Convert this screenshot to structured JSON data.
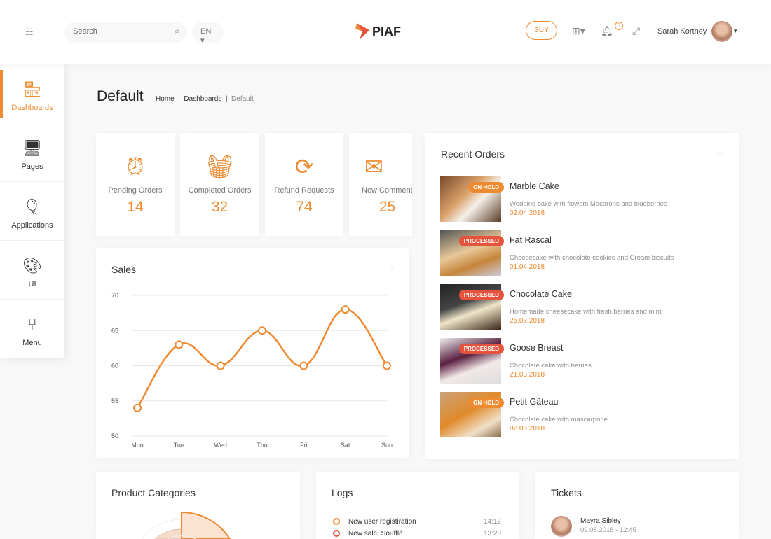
{
  "header": {
    "search_placeholder": "Search",
    "language": "EN",
    "logo_text": "PIAF",
    "buy_label": "BUY",
    "notification_count": "3",
    "user_name": "Sarah Kortney"
  },
  "sidebar": {
    "items": [
      {
        "label": "Dashboards",
        "icon": "shop-icon",
        "active": true
      },
      {
        "label": "Pages",
        "icon": "monitor-icon"
      },
      {
        "label": "Applications",
        "icon": "balloon-icon"
      },
      {
        "label": "UI",
        "icon": "palette-icon"
      },
      {
        "label": "Menu",
        "icon": "usb-icon"
      }
    ]
  },
  "page": {
    "title": "Default",
    "breadcrumb": [
      "Home",
      "Dashboards",
      "Default"
    ]
  },
  "stats": [
    {
      "label": "Pending Orders",
      "value": "14",
      "icon": "alarm-clock-icon"
    },
    {
      "label": "Completed Orders",
      "value": "32",
      "icon": "basket-icon"
    },
    {
      "label": "Refund Requests",
      "value": "74",
      "icon": "refresh-icon"
    },
    {
      "label": "New Comments",
      "value": "25",
      "icon": "mail-icon"
    }
  ],
  "sales": {
    "title": "Sales"
  },
  "chart_data": {
    "type": "line",
    "categories": [
      "Mon",
      "Tue",
      "Wed",
      "Thu",
      "Fri",
      "Sat",
      "Sun"
    ],
    "values": [
      54,
      63,
      60,
      65,
      60,
      68,
      60
    ],
    "ylim": [
      50,
      70
    ],
    "yticks": [
      50,
      55,
      60,
      65,
      70
    ],
    "grid": true,
    "color": "#ee8a2f"
  },
  "recent_orders": {
    "title": "Recent Orders",
    "items": [
      {
        "name": "Marble Cake",
        "desc": "Wedding cake with flowers Macarons and blueberries",
        "date": "02.04.2018",
        "status": "ON HOLD"
      },
      {
        "name": "Fat Rascal",
        "desc": "Cheesecake with chocolate cookies and Cream biscuits",
        "date": "01.04.2018",
        "status": "PROCESSED"
      },
      {
        "name": "Chocolate Cake",
        "desc": "Homemade cheesecake with fresh berries and mint",
        "date": "25.03.2018",
        "status": "PROCESSED"
      },
      {
        "name": "Goose Breast",
        "desc": "Chocolate cake with berries",
        "date": "21.03.2018",
        "status": "PROCESSED"
      },
      {
        "name": "Petit Gâteau",
        "desc": "Chocolate cake with mascarpone",
        "date": "02.06.2018",
        "status": "ON HOLD"
      }
    ]
  },
  "colors": {
    "accent": "#ee8a2f",
    "processed": "#e5533d",
    "on_hold": "#ee8a2f"
  },
  "product_categories": {
    "title": "Product Categories"
  },
  "logs": {
    "title": "Logs",
    "items": [
      {
        "text": "New user registiration",
        "time": "14:12"
      },
      {
        "text": "New sale: Soufflé",
        "time": "13:20"
      }
    ]
  },
  "tickets": {
    "title": "Tickets",
    "items": [
      {
        "name": "Mayra Sibley",
        "date": "09.08.2018 - 12:45"
      }
    ]
  }
}
